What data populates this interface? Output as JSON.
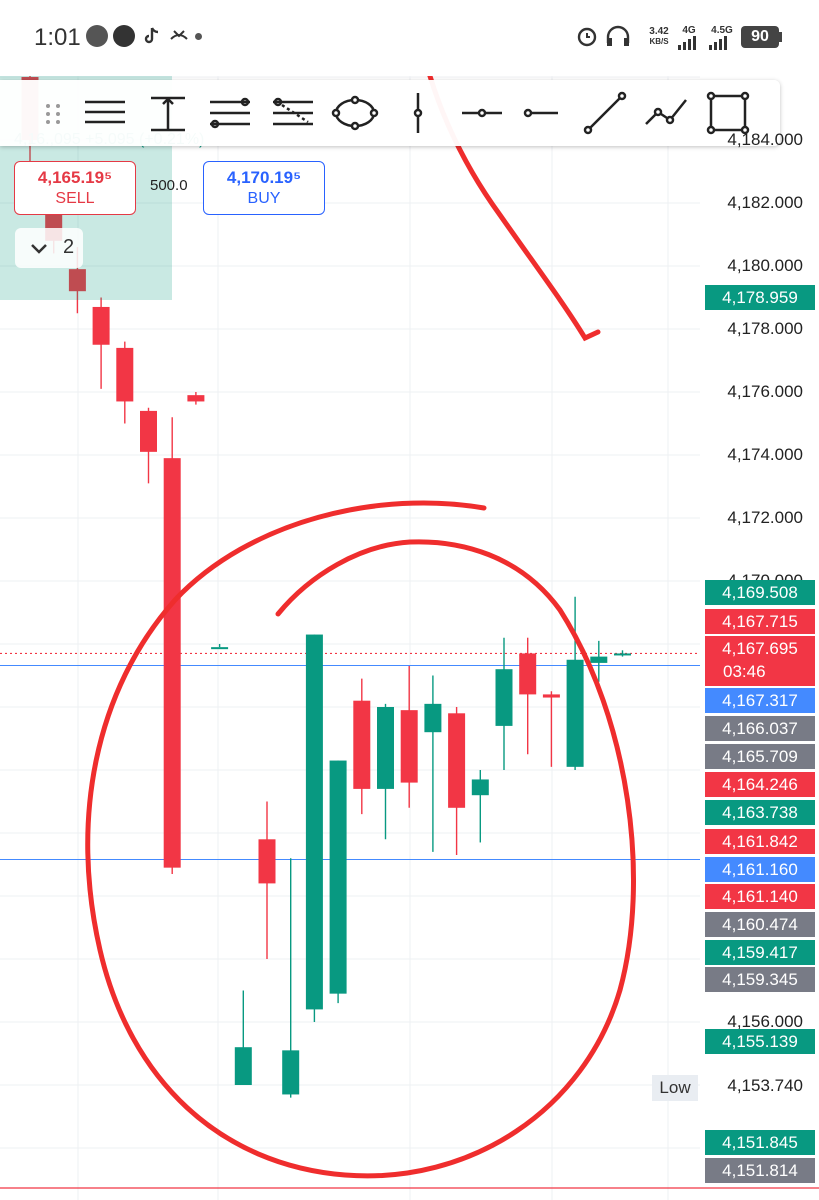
{
  "status_bar": {
    "time": "1:01",
    "net_speed": "3.42",
    "net_unit": "KB/S",
    "net_4g": "4G",
    "net_45g": "4.5G",
    "battery": "90"
  },
  "order_panel": {
    "sell_price": "4,165.19⁵",
    "sell_label": "SELL",
    "buy_price": "4,170.19⁵",
    "buy_label": "BUY",
    "quantity": "500.0",
    "collapsed_count": "2"
  },
  "axis_labels": [
    {
      "price": 4184.0,
      "text": "4,184.000"
    },
    {
      "price": 4182.0,
      "text": "4,182.000"
    },
    {
      "price": 4180.0,
      "text": "4,180.000"
    },
    {
      "price": 4178.0,
      "text": "4,178.000"
    },
    {
      "price": 4176.0,
      "text": "4,176.000"
    },
    {
      "price": 4174.0,
      "text": "4,174.000"
    },
    {
      "price": 4172.0,
      "text": "4,172.000"
    },
    {
      "price": 4170.0,
      "text": "4,170.000"
    },
    {
      "price": 4156.0,
      "text": "4,156.000"
    }
  ],
  "price_badges": [
    {
      "price": 4178.959,
      "text": "4,178.959",
      "color": "#089981"
    },
    {
      "price": 4169.508,
      "text": "4,169.508",
      "color": "#089981"
    },
    {
      "price": 4167.715,
      "text": "4,167.715",
      "color": "#f23645"
    },
    {
      "price": 4167.695,
      "text": "4,167.695",
      "color": "#f23645"
    },
    {
      "price": 4167.317,
      "text": "4,167.317",
      "color": "#448aff"
    },
    {
      "price": 4166.037,
      "text": "4,166.037",
      "color": "#787b86"
    },
    {
      "price": 4165.709,
      "text": "4,165.709",
      "color": "#787b86"
    },
    {
      "price": 4164.246,
      "text": "4,164.246",
      "color": "#f23645"
    },
    {
      "price": 4163.738,
      "text": "4,163.738",
      "color": "#089981"
    },
    {
      "price": 4161.842,
      "text": "4,161.842",
      "color": "#f23645"
    },
    {
      "price": 4161.16,
      "text": "4,161.160",
      "color": "#448aff"
    },
    {
      "price": 4161.14,
      "text": "4,161.140",
      "color": "#f23645"
    },
    {
      "price": 4160.474,
      "text": "4,160.474",
      "color": "#787b86"
    },
    {
      "price": 4159.417,
      "text": "4,159.417",
      "color": "#089981"
    },
    {
      "price": 4159.345,
      "text": "4,159.345",
      "color": "#787b86"
    },
    {
      "price": 4155.139,
      "text": "4,155.139",
      "color": "#089981"
    },
    {
      "price": 4151.845,
      "text": "4,151.845",
      "color": "#089981"
    },
    {
      "price": 4151.814,
      "text": "4,151.814",
      "color": "#787b86"
    }
  ],
  "countdown": "03:46",
  "low": {
    "label": "Low",
    "value": "4,153.740"
  },
  "candles": [
    {
      "o": 4186.0,
      "h": 4186.5,
      "l": 4183.0,
      "c": 4184.0
    },
    {
      "o": 4182.4,
      "h": 4182.7,
      "l": 4180.4,
      "c": 4180.8
    },
    {
      "o": 4179.9,
      "h": 4180.6,
      "l": 4178.5,
      "c": 4179.2
    },
    {
      "o": 4178.7,
      "h": 4179.0,
      "l": 4176.1,
      "c": 4177.5
    },
    {
      "o": 4177.4,
      "h": 4177.6,
      "l": 4175.0,
      "c": 4175.7
    },
    {
      "o": 4175.4,
      "h": 4175.5,
      "l": 4173.1,
      "c": 4174.1
    },
    {
      "o": 4173.9,
      "h": 4175.2,
      "l": 4160.7,
      "c": 4160.9
    },
    {
      "o": 4175.9,
      "h": 4176.0,
      "l": 4175.6,
      "c": 4175.7
    },
    {
      "o": 4167.9,
      "h": 4168.0,
      "l": 4167.9,
      "c": 4167.9
    },
    {
      "o": 4154.0,
      "h": 4157.0,
      "l": 4154.0,
      "c": 4155.2
    },
    {
      "o": 4161.8,
      "h": 4163.0,
      "l": 4158.0,
      "c": 4160.4
    },
    {
      "o": 4153.7,
      "h": 4161.2,
      "l": 4153.6,
      "c": 4155.1
    },
    {
      "o": 4156.4,
      "h": 4168.3,
      "l": 4156.0,
      "c": 4168.3
    },
    {
      "o": 4156.9,
      "h": 4164.3,
      "l": 4156.6,
      "c": 4164.3
    },
    {
      "o": 4166.2,
      "h": 4166.9,
      "l": 4162.6,
      "c": 4163.4
    },
    {
      "o": 4163.4,
      "h": 4166.1,
      "l": 4161.8,
      "c": 4166.0
    },
    {
      "o": 4165.9,
      "h": 4167.3,
      "l": 4162.8,
      "c": 4163.6
    },
    {
      "o": 4165.2,
      "h": 4167.0,
      "l": 4161.4,
      "c": 4166.1
    },
    {
      "o": 4165.8,
      "h": 4166.0,
      "l": 4161.3,
      "c": 4162.8
    },
    {
      "o": 4163.2,
      "h": 4164.0,
      "l": 4161.7,
      "c": 4163.7
    },
    {
      "o": 4165.4,
      "h": 4168.2,
      "l": 4164.0,
      "c": 4167.2
    },
    {
      "o": 4167.7,
      "h": 4168.2,
      "l": 4164.5,
      "c": 4166.4
    },
    {
      "o": 4166.4,
      "h": 4166.5,
      "l": 4164.1,
      "c": 4166.3
    },
    {
      "o": 4164.1,
      "h": 4169.5,
      "l": 4164.0,
      "c": 4167.5
    },
    {
      "o": 4167.4,
      "h": 4168.1,
      "l": 4166.8,
      "c": 4167.6
    },
    {
      "o": 4167.7,
      "h": 4167.8,
      "l": 4167.6,
      "c": 4167.7
    }
  ]
}
